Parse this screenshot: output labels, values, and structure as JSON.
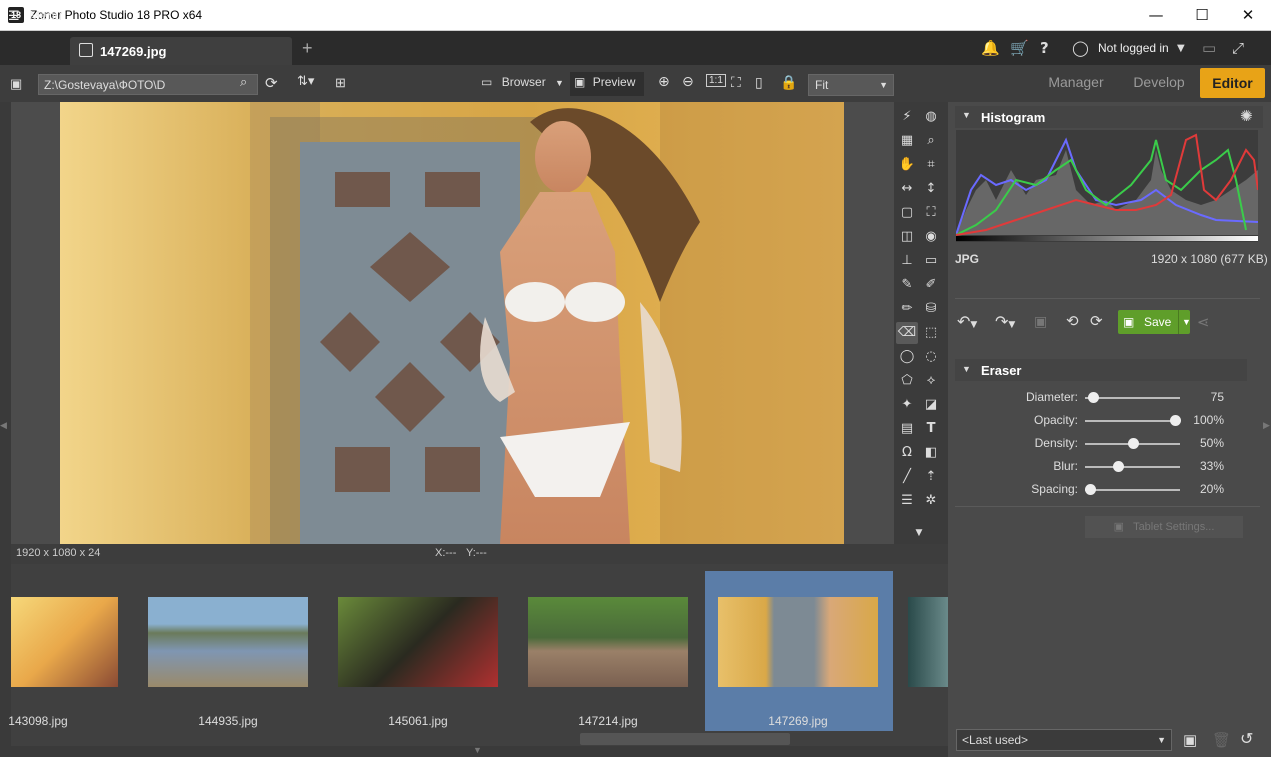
{
  "window": {
    "title": "Zoner Photo Studio 18 PRO x64",
    "app_icon": "18",
    "minimize": "—",
    "maximize": "☐",
    "close": "✕"
  },
  "menubar": {
    "menu_label": "Menu",
    "tab_name": "147269.jpg",
    "add_tab": "+",
    "user": "Not logged in"
  },
  "toolbar": {
    "path": "Z:\\Gostevaya\\ФОТО\\D",
    "browser": "Browser",
    "preview": "Preview",
    "fit": "Fit",
    "modes": {
      "manager": "Manager",
      "develop": "Develop",
      "editor": "Editor"
    }
  },
  "status": {
    "dimensions": "1920 x 1080 x 24",
    "coords_x": "X:---",
    "coords_y": "Y:---"
  },
  "filmstrip": [
    {
      "name": "143098.jpg",
      "colors": [
        "#f3c15a",
        "#7a3a2a"
      ]
    },
    {
      "name": "144935.jpg",
      "colors": [
        "#6e8fb0",
        "#8a7a5a"
      ]
    },
    {
      "name": "145061.jpg",
      "colors": [
        "#3a5a2a",
        "#201818"
      ]
    },
    {
      "name": "147214.jpg",
      "colors": [
        "#4f7a3a",
        "#8a7060"
      ]
    },
    {
      "name": "147269.jpg",
      "colors": [
        "#e0b458",
        "#6a7a8a"
      ],
      "selected": true
    }
  ],
  "histogram": {
    "title": "Histogram",
    "format": "JPG",
    "info": "1920 x 1080 (677 KB)"
  },
  "actions": {
    "save": "Save"
  },
  "eraser": {
    "title": "Eraser",
    "params": [
      {
        "label": "Diameter:",
        "value": "75",
        "level": 0.08
      },
      {
        "label": "Opacity:",
        "value": "100%",
        "level": 0.95
      },
      {
        "label": "Density:",
        "value": "50%",
        "level": 0.5
      },
      {
        "label": "Blur:",
        "value": "33%",
        "level": 0.35
      },
      {
        "label": "Spacing:",
        "value": "20%",
        "level": 0.05
      }
    ],
    "tablet": "Tablet Settings..."
  },
  "presets": {
    "selected": "<Last used>"
  },
  "colors": {
    "accent": "#e8a317",
    "save": "#5f9e2a",
    "selection": "#5b7da8"
  }
}
